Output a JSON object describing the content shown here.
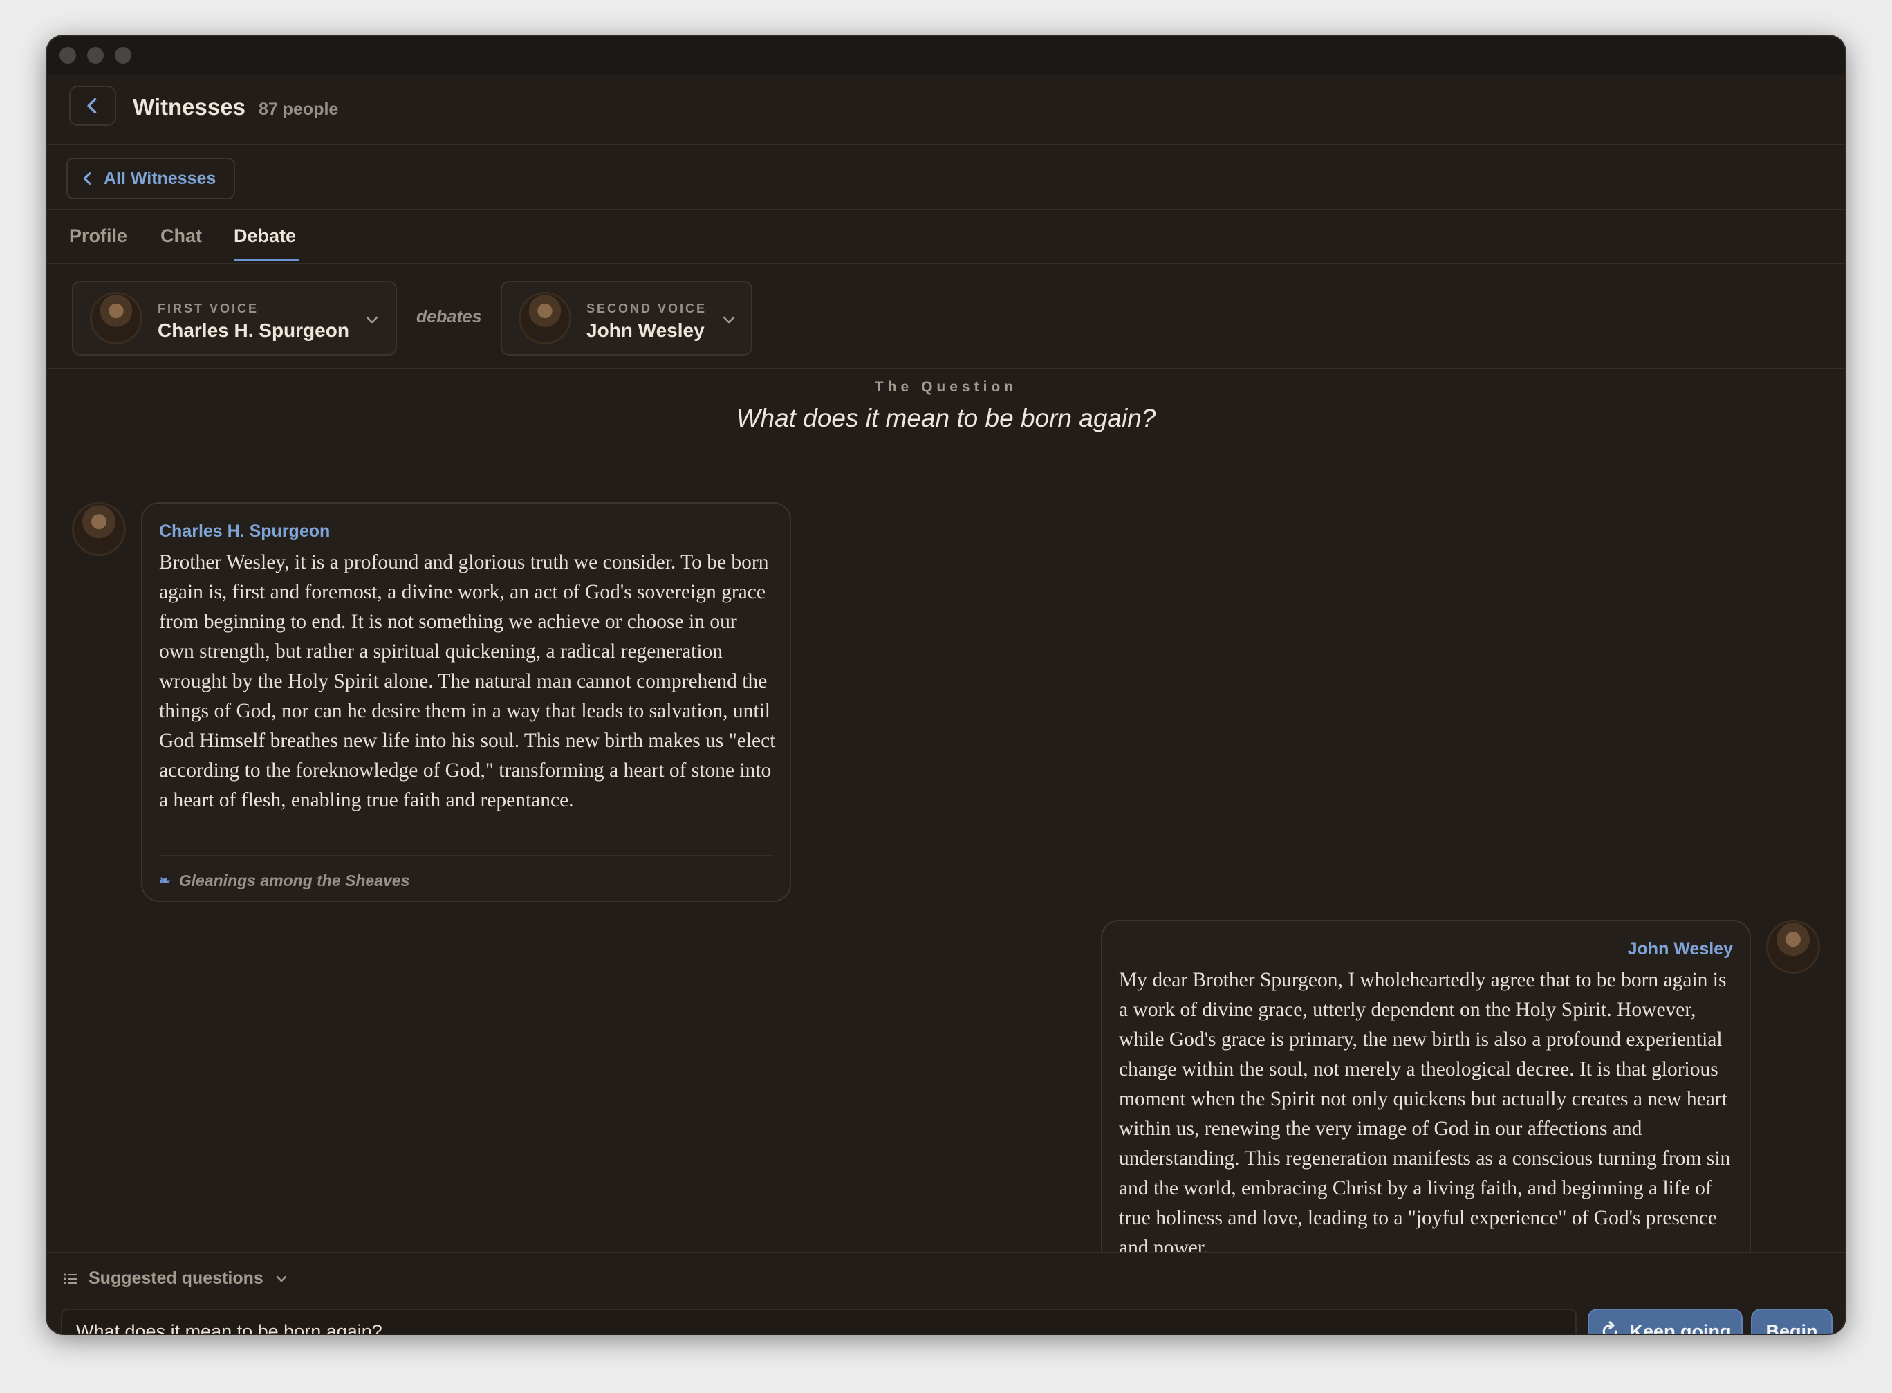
{
  "header": {
    "title": "Witnesses",
    "count": "87 people"
  },
  "nav": {
    "all_witnesses": "All Witnesses"
  },
  "tabs": [
    {
      "label": "Profile",
      "active": false
    },
    {
      "label": "Chat",
      "active": false
    },
    {
      "label": "Debate",
      "active": true
    }
  ],
  "debate": {
    "first_voice": {
      "label": "FIRST VOICE",
      "name": "Charles H. Spurgeon"
    },
    "connector": "debates",
    "second_voice": {
      "label": "SECOND VOICE",
      "name": "John Wesley"
    },
    "question_label": "The Question",
    "question": "What does it mean to be born again?"
  },
  "messages": [
    {
      "speaker": "Charles H. Spurgeon",
      "text": "Brother Wesley, it is a profound and glorious truth we consider. To be born again is, first and foremost, a divine work, an act of God's sovereign grace from beginning to end. It is not something we achieve or choose in our own strength, but rather a spiritual quickening, a radical regeneration wrought by the Holy Spirit alone. The natural man cannot comprehend the things of God, nor can he desire them in a way that leads to salvation, until God Himself breathes new life into his soul. This new birth makes us \"elect according to the foreknowledge of God,\" transforming a heart of stone into a heart of flesh, enabling true faith and repentance.",
      "source": "Gleanings among the Sheaves"
    },
    {
      "speaker": "John Wesley",
      "text": "My dear Brother Spurgeon, I wholeheartedly agree that to be born again is a work of divine grace, utterly dependent on the Holy Spirit. However, while God's grace is primary, the new birth is also a profound experiential change within the soul, not merely a theological decree. It is that glorious moment when the Spirit not only quickens but actually creates a new heart within us, renewing the very image of God in our affections and understanding. This regeneration manifests as a conscious turning from sin and the world, embracing Christ by a living faith, and beginning a life of true holiness and love, leading to a \"joyful experience\" of God's presence and power."
    }
  ],
  "composer": {
    "suggested_label": "Suggested questions",
    "input_value": "What does it mean to be born again?",
    "keep_going": "Keep going",
    "begin": "Begin"
  },
  "colors": {
    "accent": "#7fa4d8",
    "background": "#221d18",
    "button": "#4c6c9c"
  }
}
